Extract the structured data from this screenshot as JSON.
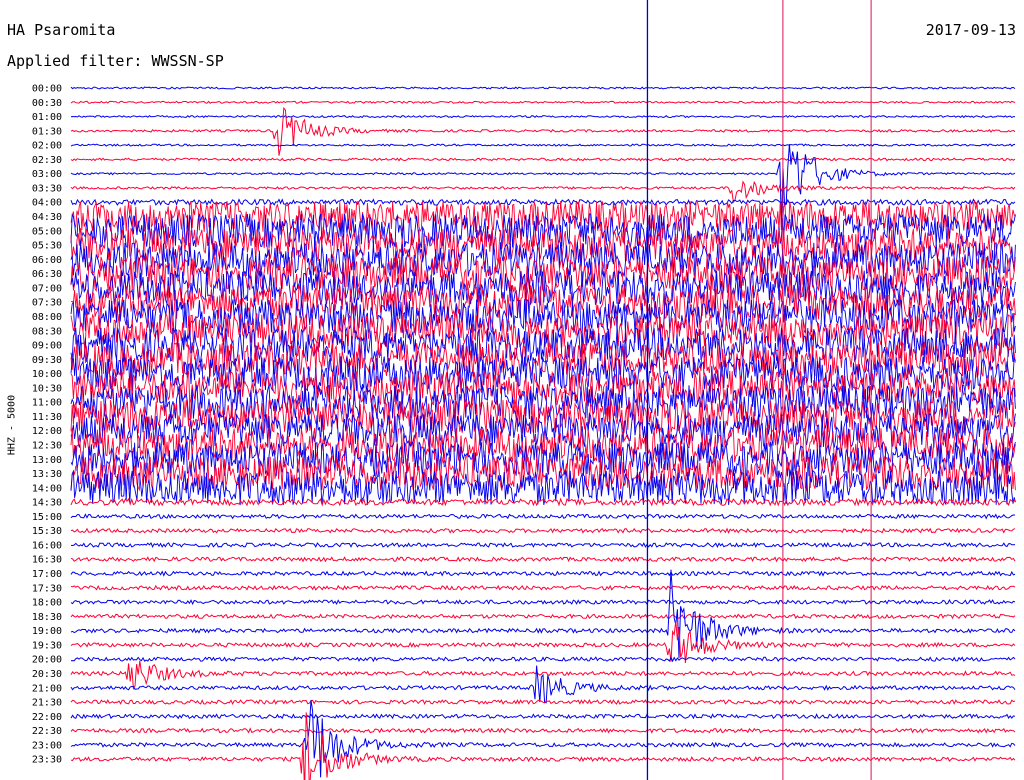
{
  "header": {
    "station": "HA Psaromita",
    "filter": "Applied filter: WWSSN-SP",
    "date": "2017-09-13"
  },
  "chart_data": {
    "type": "line",
    "subtype": "helicorder",
    "ylabel": "HHZ - 5000",
    "trace_colors": [
      "#0000ee",
      "#ff0033"
    ],
    "marker_color_blue": "#0000cc",
    "marker_color_red": "#dd1155",
    "row_labels": [
      "00:00",
      "00:30",
      "01:00",
      "01:30",
      "02:00",
      "02:30",
      "03:00",
      "03:30",
      "04:00",
      "04:30",
      "05:00",
      "05:30",
      "06:00",
      "06:30",
      "07:00",
      "07:30",
      "08:00",
      "08:30",
      "09:00",
      "09:30",
      "10:00",
      "10:30",
      "11:00",
      "11:30",
      "12:00",
      "12:30",
      "13:00",
      "13:30",
      "14:00",
      "14:30",
      "15:00",
      "15:30",
      "16:00",
      "16:30",
      "17:00",
      "17:30",
      "18:00",
      "18:30",
      "19:00",
      "19:30",
      "20:00",
      "20:30",
      "21:00",
      "21:30",
      "22:00",
      "22:30",
      "23:00",
      "23:30"
    ],
    "markers_minute": [
      {
        "color": "blue",
        "minute": 18.3
      },
      {
        "color": "red",
        "minute": 22.6
      },
      {
        "color": "red",
        "minute": 25.4
      }
    ],
    "noise_level_by_row": [
      0.12,
      0.12,
      0.12,
      0.15,
      0.12,
      0.15,
      0.12,
      0.15,
      0.35,
      0.9,
      1,
      1,
      1,
      1,
      1,
      1,
      1,
      1,
      1,
      1,
      1,
      1,
      1,
      1,
      1,
      1,
      1,
      1,
      1,
      0.4,
      0.25,
      0.25,
      0.25,
      0.25,
      0.25,
      0.25,
      0.25,
      0.25,
      0.25,
      0.25,
      0.25,
      0.25,
      0.25,
      0.25,
      0.25,
      0.25,
      0.25,
      0.25
    ],
    "events": [
      {
        "row": 3,
        "minute": 6.5,
        "amp": 2.2
      },
      {
        "row": 7,
        "minute": 21.0,
        "amp": 1.2
      },
      {
        "row": 6,
        "minute": 22.5,
        "amp": 4.5
      },
      {
        "row": 38,
        "minute": 19.0,
        "amp": 4.5
      },
      {
        "row": 39,
        "minute": 19.0,
        "amp": 2.2
      },
      {
        "row": 41,
        "minute": 1.8,
        "amp": 1.5
      },
      {
        "row": 42,
        "minute": 14.7,
        "amp": 1.6
      },
      {
        "row": 46,
        "minute": 7.5,
        "amp": 4.0
      },
      {
        "row": 47,
        "minute": 7.4,
        "amp": 3.5
      }
    ]
  }
}
